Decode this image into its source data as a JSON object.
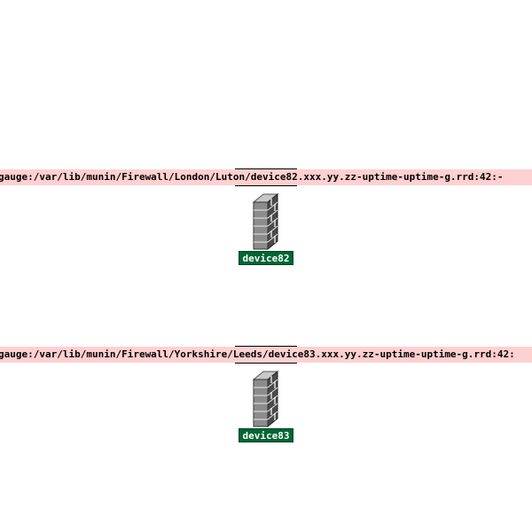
{
  "nodes": [
    {
      "hover_text": "gauge:/var/lib/munin/Firewall/London/Luton/device82.xxx.yy.zz-uptime-uptime-g.rrd:42:-",
      "label": "device82",
      "icon": "firewall-brick-wall-icon"
    },
    {
      "hover_text": "gauge:/var/lib/munin/Firewall/Yorkshire/Leeds/device83.xxx.yy.zz-uptime-uptime-g.rrd:42:",
      "label": "device83",
      "icon": "firewall-brick-wall-icon"
    }
  ],
  "colors": {
    "path_bar": "#ffd0d0",
    "label_bg": "#006633",
    "label_text": "#ffffff"
  }
}
